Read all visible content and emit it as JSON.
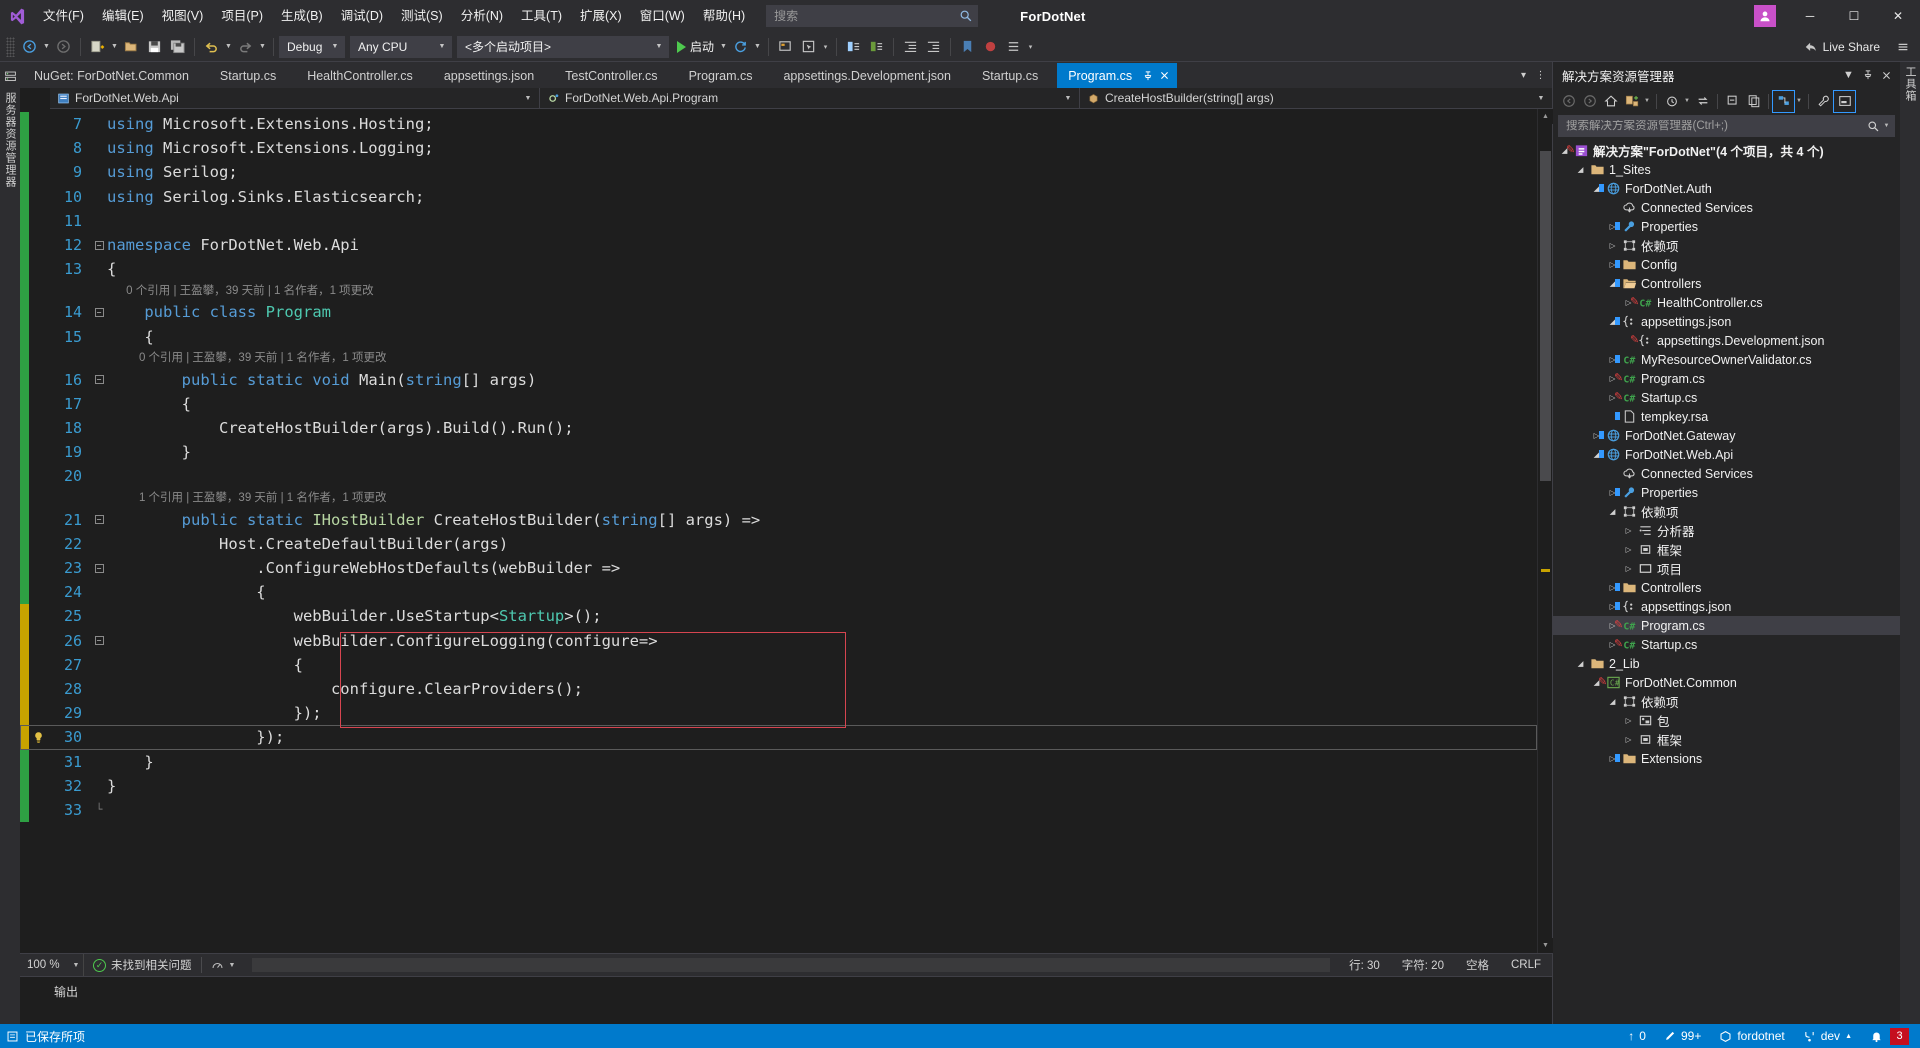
{
  "window": {
    "app_title": "ForDotNet",
    "minimize_label": "─",
    "maximize_label": "☐",
    "close_label": "✕",
    "account_initial": "⌗"
  },
  "menu": {
    "items": [
      {
        "label": "文件(F)",
        "name": "menu-file"
      },
      {
        "label": "编辑(E)",
        "name": "menu-edit"
      },
      {
        "label": "视图(V)",
        "name": "menu-view"
      },
      {
        "label": "项目(P)",
        "name": "menu-project"
      },
      {
        "label": "生成(B)",
        "name": "menu-build"
      },
      {
        "label": "调试(D)",
        "name": "menu-debug"
      },
      {
        "label": "测试(S)",
        "name": "menu-test"
      },
      {
        "label": "分析(N)",
        "name": "menu-analyze"
      },
      {
        "label": "工具(T)",
        "name": "menu-tools"
      },
      {
        "label": "扩展(X)",
        "name": "menu-extensions"
      },
      {
        "label": "窗口(W)",
        "name": "menu-window"
      },
      {
        "label": "帮助(H)",
        "name": "menu-help"
      }
    ],
    "search_placeholder": "搜索"
  },
  "toolbar": {
    "config": "Debug",
    "platform": "Any CPU",
    "startup_project": "<多个启动项目>",
    "run_label": "启动",
    "live_share": "Live Share"
  },
  "tabs": [
    {
      "label": "NuGet: ForDotNet.Common",
      "active": false
    },
    {
      "label": "Startup.cs",
      "active": false
    },
    {
      "label": "HealthController.cs",
      "active": false
    },
    {
      "label": "appsettings.json",
      "active": false
    },
    {
      "label": "TestController.cs",
      "active": false
    },
    {
      "label": "Program.cs",
      "active": false
    },
    {
      "label": "appsettings.Development.json",
      "active": false
    },
    {
      "label": "Startup.cs",
      "active": false
    },
    {
      "label": "Program.cs",
      "active": true
    }
  ],
  "navbar": {
    "project": "ForDotNet.Web.Api",
    "type": "ForDotNet.Web.Api.Program",
    "member": "CreateHostBuilder(string[] args)"
  },
  "editor": {
    "lines": [
      {
        "n": "7",
        "fold": "",
        "indicator": "saved",
        "segs": [
          {
            "t": "using ",
            "c": "kw"
          },
          {
            "t": "Microsoft.Extensions.Hosting;",
            "c": "pln"
          }
        ]
      },
      {
        "n": "8",
        "fold": "",
        "indicator": "saved",
        "segs": [
          {
            "t": "using ",
            "c": "kw"
          },
          {
            "t": "Microsoft.Extensions.Logging;",
            "c": "pln"
          }
        ]
      },
      {
        "n": "9",
        "fold": "",
        "indicator": "saved",
        "segs": [
          {
            "t": "using ",
            "c": "kw"
          },
          {
            "t": "Serilog;",
            "c": "pln"
          }
        ]
      },
      {
        "n": "10",
        "fold": "",
        "indicator": "saved",
        "segs": [
          {
            "t": "using ",
            "c": "kw"
          },
          {
            "t": "Serilog.Sinks.Elasticsearch;",
            "c": "pln"
          }
        ]
      },
      {
        "n": "11",
        "fold": "",
        "indicator": "saved",
        "segs": []
      },
      {
        "n": "12",
        "fold": "minus",
        "indicator": "saved",
        "segs": [
          {
            "t": "namespace ",
            "c": "kw"
          },
          {
            "t": "ForDotNet.Web.Api",
            "c": "pln"
          }
        ]
      },
      {
        "n": "13",
        "fold": "",
        "indicator": "saved",
        "segs": [
          {
            "t": "{",
            "c": "pln"
          }
        ]
      },
      {
        "n": "",
        "lens": "      0 个引用 | 王盈攀，39 天前 | 1 名作者，1 项更改",
        "indicator": "saved"
      },
      {
        "n": "14",
        "fold": "minus",
        "indicator": "saved",
        "segs": [
          {
            "t": "    ",
            "c": "dim"
          },
          {
            "t": "public ",
            "c": "kw"
          },
          {
            "t": "class ",
            "c": "kw"
          },
          {
            "t": "Program",
            "c": "cls"
          }
        ]
      },
      {
        "n": "15",
        "fold": "",
        "indicator": "saved",
        "segs": [
          {
            "t": "    {",
            "c": "pln"
          }
        ]
      },
      {
        "n": "",
        "lens": "          0 个引用 | 王盈攀，39 天前 | 1 名作者，1 项更改",
        "indicator": "saved"
      },
      {
        "n": "16",
        "fold": "minus",
        "indicator": "saved",
        "segs": [
          {
            "t": "        ",
            "c": "dim"
          },
          {
            "t": "public ",
            "c": "kw"
          },
          {
            "t": "static ",
            "c": "kw"
          },
          {
            "t": "void ",
            "c": "kw"
          },
          {
            "t": "Main",
            "c": "pln"
          },
          {
            "t": "(",
            "c": "pln"
          },
          {
            "t": "string",
            "c": "kw"
          },
          {
            "t": "[] args)",
            "c": "pln"
          }
        ]
      },
      {
        "n": "17",
        "fold": "",
        "indicator": "saved",
        "segs": [
          {
            "t": "        {",
            "c": "pln"
          }
        ]
      },
      {
        "n": "18",
        "fold": "",
        "indicator": "saved",
        "segs": [
          {
            "t": "            CreateHostBuilder(args).Build().Run();",
            "c": "pln"
          }
        ]
      },
      {
        "n": "19",
        "fold": "",
        "indicator": "saved",
        "segs": [
          {
            "t": "        }",
            "c": "pln"
          }
        ]
      },
      {
        "n": "20",
        "fold": "",
        "indicator": "saved",
        "segs": []
      },
      {
        "n": "",
        "lens": "          1 个引用 | 王盈攀，39 天前 | 1 名作者，1 项更改",
        "indicator": "saved"
      },
      {
        "n": "21",
        "fold": "minus",
        "indicator": "saved",
        "segs": [
          {
            "t": "        ",
            "c": "dim"
          },
          {
            "t": "public ",
            "c": "kw"
          },
          {
            "t": "static ",
            "c": "kw"
          },
          {
            "t": "IHostBuilder",
            "c": "iface"
          },
          {
            "t": " CreateHostBuilder(",
            "c": "pln"
          },
          {
            "t": "string",
            "c": "kw"
          },
          {
            "t": "[] args) =>",
            "c": "pln"
          }
        ]
      },
      {
        "n": "22",
        "fold": "",
        "indicator": "saved",
        "segs": [
          {
            "t": "            Host.CreateDefaultBuilder(args)",
            "c": "pln"
          }
        ]
      },
      {
        "n": "23",
        "fold": "minus",
        "indicator": "saved",
        "segs": [
          {
            "t": "                .ConfigureWebHostDefaults(webBuilder =>",
            "c": "pln"
          }
        ]
      },
      {
        "n": "24",
        "fold": "",
        "indicator": "saved",
        "segs": [
          {
            "t": "                {",
            "c": "pln"
          }
        ]
      },
      {
        "n": "25",
        "fold": "",
        "indicator": "unsaved",
        "segs": [
          {
            "t": "                    webBuilder.UseStartup<",
            "c": "pln"
          },
          {
            "t": "Startup",
            "c": "cls"
          },
          {
            "t": ">();",
            "c": "pln"
          }
        ]
      },
      {
        "n": "26",
        "fold": "minus",
        "indicator": "unsaved",
        "segs": [
          {
            "t": "                    webBuilder.ConfigureLogging(configure=>",
            "c": "pln"
          }
        ]
      },
      {
        "n": "27",
        "fold": "",
        "indicator": "unsaved",
        "segs": [
          {
            "t": "                    {",
            "c": "pln"
          }
        ]
      },
      {
        "n": "28",
        "fold": "",
        "indicator": "unsaved",
        "segs": [
          {
            "t": "                        configure.ClearProviders();",
            "c": "pln"
          }
        ]
      },
      {
        "n": "29",
        "fold": "",
        "indicator": "unsaved",
        "segs": [
          {
            "t": "                    });",
            "c": "pln"
          }
        ]
      },
      {
        "n": "30",
        "fold": "",
        "indicator": "unsaved",
        "bulb": true,
        "current": true,
        "segs": [
          {
            "t": "                });",
            "c": "pln"
          }
        ]
      },
      {
        "n": "31",
        "fold": "",
        "indicator": "saved",
        "segs": [
          {
            "t": "    }",
            "c": "pln"
          }
        ]
      },
      {
        "n": "32",
        "fold": "",
        "indicator": "saved",
        "segs": [
          {
            "t": "}",
            "c": "pln"
          }
        ]
      },
      {
        "n": "33",
        "fold": "end",
        "indicator": "saved",
        "segs": []
      }
    ]
  },
  "editor_status": {
    "zoom": "100 %",
    "issues": "未找到相关问题",
    "line": "行: 30",
    "col": "字符: 20",
    "spaces": "空格",
    "eol": "CRLF"
  },
  "output": {
    "title": "输出"
  },
  "solution_explorer": {
    "title": "解决方案资源管理器",
    "search_placeholder": "搜索解决方案资源管理器(Ctrl+;)",
    "toolbar_icons": [
      "back-icon",
      "forward-icon",
      "home-icon",
      "sync-with-active-document-icon",
      "pending-changes-filter-icon",
      "refresh-icon",
      "collapse-all-icon",
      "show-all-files-icon",
      "view-class-diagram-icon",
      "properties-icon",
      "preview-selected-items-icon"
    ],
    "tree": [
      {
        "depth": 0,
        "twist": "open",
        "icon": "solution",
        "label": "解决方案\"ForDotNet\"(4 个项目，共 4 个)",
        "bold": true,
        "pending": true
      },
      {
        "depth": 1,
        "twist": "open",
        "icon": "folder",
        "label": "1_Sites"
      },
      {
        "depth": 2,
        "twist": "open",
        "icon": "webproject",
        "label": "ForDotNet.Auth",
        "lock": true
      },
      {
        "depth": 3,
        "twist": "none",
        "icon": "connected",
        "label": "Connected Services"
      },
      {
        "depth": 3,
        "twist": "closed",
        "icon": "properties",
        "label": "Properties",
        "lock": true
      },
      {
        "depth": 3,
        "twist": "closed",
        "icon": "deps",
        "label": "依赖项"
      },
      {
        "depth": 3,
        "twist": "closed",
        "icon": "folder",
        "label": "Config",
        "lock": true
      },
      {
        "depth": 3,
        "twist": "open",
        "icon": "folderopen",
        "label": "Controllers",
        "lock": true
      },
      {
        "depth": 4,
        "twist": "closed",
        "icon": "csharp",
        "label": "HealthController.cs",
        "pending": true
      },
      {
        "depth": 3,
        "twist": "open",
        "icon": "json",
        "label": "appsettings.json",
        "lock": true
      },
      {
        "depth": 4,
        "twist": "none",
        "icon": "json",
        "label": "appsettings.Development.json",
        "pending": true
      },
      {
        "depth": 3,
        "twist": "closed",
        "icon": "csharp",
        "label": "MyResourceOwnerValidator.cs",
        "lock": true
      },
      {
        "depth": 3,
        "twist": "closed",
        "icon": "csharp",
        "label": "Program.cs",
        "pending": true
      },
      {
        "depth": 3,
        "twist": "closed",
        "icon": "csharp",
        "label": "Startup.cs",
        "pending": true
      },
      {
        "depth": 3,
        "twist": "none",
        "icon": "file",
        "label": "tempkey.rsa",
        "lock": true
      },
      {
        "depth": 2,
        "twist": "closed",
        "icon": "webproject",
        "label": "ForDotNet.Gateway",
        "lock": true
      },
      {
        "depth": 2,
        "twist": "open",
        "icon": "webproject",
        "label": "ForDotNet.Web.Api",
        "lock": true
      },
      {
        "depth": 3,
        "twist": "none",
        "icon": "connected",
        "label": "Connected Services"
      },
      {
        "depth": 3,
        "twist": "closed",
        "icon": "properties",
        "label": "Properties",
        "lock": true
      },
      {
        "depth": 3,
        "twist": "open",
        "icon": "deps",
        "label": "依赖项"
      },
      {
        "depth": 4,
        "twist": "closed",
        "icon": "analyzers",
        "label": "分析器"
      },
      {
        "depth": 4,
        "twist": "closed",
        "icon": "framework",
        "label": "框架"
      },
      {
        "depth": 4,
        "twist": "closed",
        "icon": "projects",
        "label": "项目"
      },
      {
        "depth": 3,
        "twist": "closed",
        "icon": "folder",
        "label": "Controllers",
        "lock": true
      },
      {
        "depth": 3,
        "twist": "closed",
        "icon": "json",
        "label": "appsettings.json",
        "lock": true
      },
      {
        "depth": 3,
        "twist": "closed",
        "icon": "csharp",
        "label": "Program.cs",
        "pending": true,
        "selected": true
      },
      {
        "depth": 3,
        "twist": "closed",
        "icon": "csharp",
        "label": "Startup.cs",
        "pending": true
      },
      {
        "depth": 1,
        "twist": "open",
        "icon": "folder",
        "label": "2_Lib"
      },
      {
        "depth": 2,
        "twist": "open",
        "icon": "cslib",
        "label": "ForDotNet.Common",
        "pending": true
      },
      {
        "depth": 3,
        "twist": "open",
        "icon": "deps",
        "label": "依赖项"
      },
      {
        "depth": 4,
        "twist": "closed",
        "icon": "packages",
        "label": "包"
      },
      {
        "depth": 4,
        "twist": "closed",
        "icon": "framework",
        "label": "框架"
      },
      {
        "depth": 3,
        "twist": "closed",
        "icon": "folder",
        "label": "Extensions",
        "lock": true
      }
    ]
  },
  "left_rail": {
    "label": "服务器资源管理器"
  },
  "right_rail": {
    "label": "工具箱"
  },
  "statusbar": {
    "saved_label": "已保存所项",
    "up_count": "0",
    "pending_count": "99+",
    "repo": "fordotnet",
    "branch": "dev",
    "notif_count": "3"
  },
  "colors": {
    "accent": "#007acc",
    "title_bg": "#2d2d30",
    "editor_bg": "#1e1e1e",
    "panel_bg": "#252526",
    "keyword": "#569cd6",
    "class": "#4ec9b0",
    "interface": "#b8d7a3",
    "linenum": "#3a9bd0",
    "saved_marker": "#2ea043",
    "unsaved_marker": "#c8a300",
    "redbox": "#d64550",
    "badge": "#c50f1f"
  }
}
